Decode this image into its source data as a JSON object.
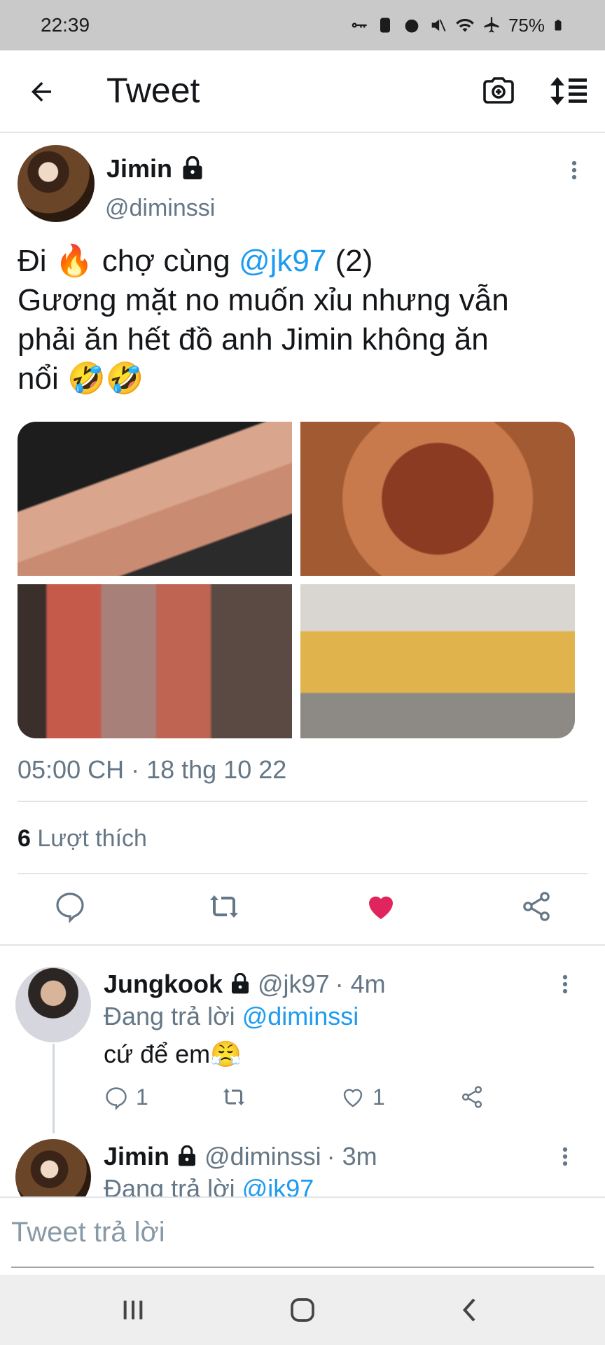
{
  "status_bar": {
    "time": "22:39",
    "battery": "75%"
  },
  "header": {
    "title": "Tweet"
  },
  "tweet": {
    "author_name": "Jimin",
    "author_handle": "@diminssi",
    "text_line1_a": "Đi 🔥 chợ cùng ",
    "text_mention": "@jk97",
    "text_line1_b": " (2)",
    "text_line2": "Gương mặt no muốn xỉu nhưng vẫn",
    "text_line3": "phải ăn hết đồ anh Jimin không ăn",
    "text_line4": "nổi 🤣🤣",
    "timestamp": "05:00 CH · 18 thg 10 22",
    "likes_count": "6",
    "likes_label": "Lượt thích",
    "liked": true
  },
  "replies": [
    {
      "name": "Jungkook",
      "handle": "@jk97",
      "time": "· 4m",
      "replying_to_label": "Đang trả lời",
      "replying_to": "@diminssi",
      "text": "cứ để em😤",
      "reply_count": "1",
      "like_count": "1"
    },
    {
      "name": "Jimin",
      "handle": "@diminssi",
      "time": "· 3m",
      "replying_to_label": "Đang trả lời",
      "replying_to": "@jk97"
    }
  ],
  "reply_box": {
    "placeholder": "Tweet trả lời"
  },
  "colors": {
    "accent": "#1d9bf0",
    "like": "#e0245e",
    "secondary_text": "#657786"
  },
  "icons": [
    "back-arrow-icon",
    "camera-icon",
    "sort-icon",
    "more-icon",
    "lock-icon",
    "reply-icon",
    "retweet-icon",
    "heart-icon",
    "share-icon"
  ]
}
